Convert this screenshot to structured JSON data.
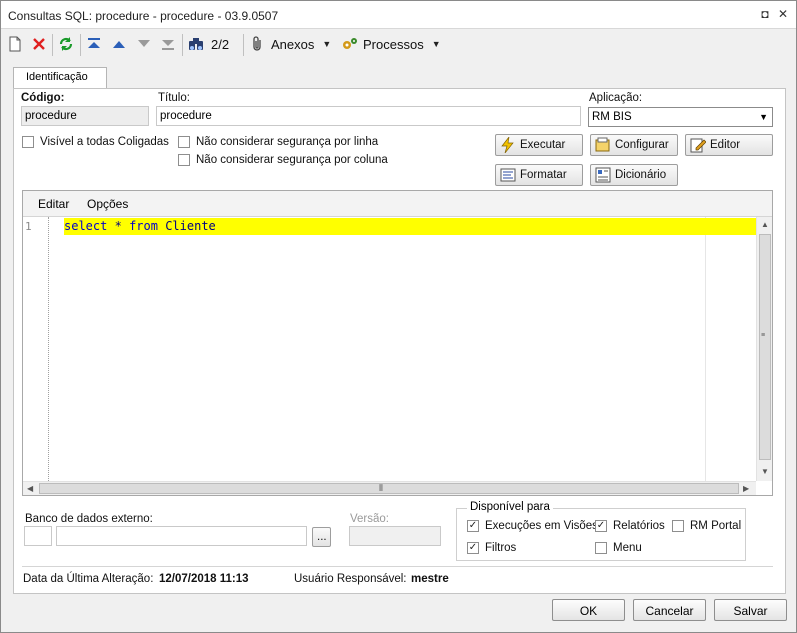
{
  "window": {
    "title": "Consultas SQL: procedure - procedure - 03.9.0507",
    "restore_glyph": "◘",
    "close_glyph": "✕"
  },
  "toolbar": {
    "record_position": "2/2",
    "attachments_label": "Anexos",
    "processes_label": "Processos",
    "icons": [
      "new-document-icon",
      "delete-icon",
      "refresh-icon",
      "first-record-icon",
      "previous-record-icon",
      "next-record-icon",
      "last-record-icon",
      "binoculars-icon",
      "paperclip-icon",
      "processes-icon"
    ]
  },
  "tabs": [
    {
      "label": "Identificação",
      "active": true
    }
  ],
  "form": {
    "code_label": "Código:",
    "code_value": "procedure",
    "title_label": "Título:",
    "title_value": "procedure",
    "application_label": "Aplicação:",
    "application_value": "RM BIS",
    "visible_all_label": "Visível a todas Coligadas",
    "ignore_row_security_label": "Não considerar segurança por linha",
    "ignore_col_security_label": "Não considerar segurança por coluna"
  },
  "buttons": {
    "execute": "Executar",
    "configure": "Configurar",
    "editor": "Editor",
    "format": "Formatar",
    "dictionary": "Dicionário"
  },
  "editor": {
    "menu_edit": "Editar",
    "menu_options": "Opções",
    "line_number": "1",
    "code_kw1": "select",
    "code_star": "*",
    "code_kw2": "from",
    "code_table": "Cliente"
  },
  "external_db": {
    "label": "Banco de dados externo:",
    "browse_label": "...",
    "version_label": "Versão:"
  },
  "available": {
    "legend": "Disponível para",
    "items": [
      {
        "label": "Execuções em Visões",
        "checked": true
      },
      {
        "label": "Relatórios",
        "checked": true
      },
      {
        "label": "RM Portal",
        "checked": false
      },
      {
        "label": "Filtros",
        "checked": true
      },
      {
        "label": "Menu",
        "checked": false
      }
    ]
  },
  "footer": {
    "last_change_label": "Data da Última Alteração:",
    "last_change_value": "12/07/2018 11:13",
    "responsible_label": "Usuário Responsável:",
    "responsible_value": "mestre"
  },
  "dialog": {
    "ok": "OK",
    "cancel": "Cancelar",
    "save": "Salvar"
  },
  "colors": {
    "highlight_line": "#ffff00",
    "keyword": "#0000cc"
  }
}
